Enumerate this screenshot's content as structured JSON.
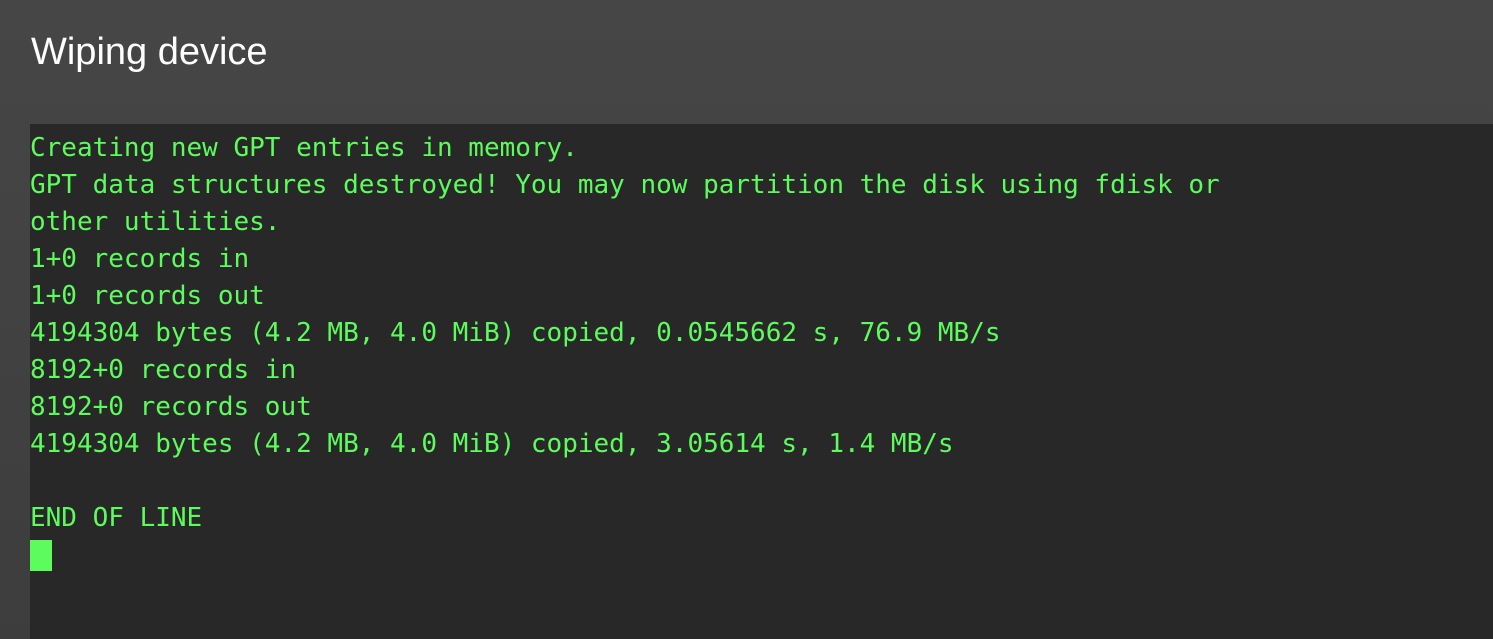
{
  "window": {
    "title": "Wiping device"
  },
  "terminal": {
    "lines": [
      "Creating new GPT entries in memory.",
      "GPT data structures destroyed! You may now partition the disk using fdisk or",
      "other utilities.",
      "1+0 records in",
      "1+0 records out",
      "4194304 bytes (4.2 MB, 4.0 MiB) copied, 0.0545662 s, 76.9 MB/s",
      "8192+0 records in",
      "8192+0 records out",
      "4194304 bytes (4.2 MB, 4.0 MiB) copied, 3.05614 s, 1.4 MB/s",
      "",
      "END OF LINE"
    ],
    "text_color": "#5dfc5d",
    "background_color": "#282828"
  }
}
